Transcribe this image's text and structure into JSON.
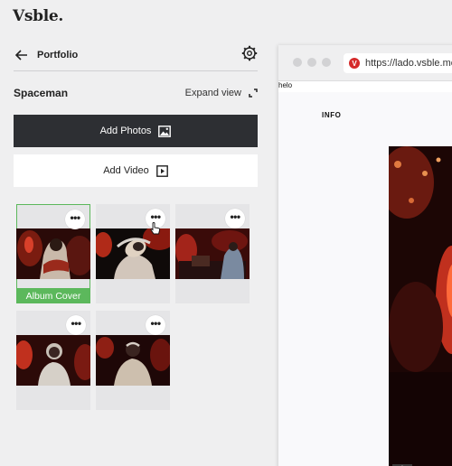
{
  "brand": {
    "logo_text": "Vsble."
  },
  "nav": {
    "title": "Portfolio",
    "back_icon": "arrow-left-icon",
    "settings_icon": "gear-icon"
  },
  "album": {
    "title": "Spaceman",
    "expand_label": "Expand view",
    "expand_icon": "expand-icon"
  },
  "actions": {
    "add_photos_label": "Add Photos",
    "add_photos_icon": "image-icon",
    "add_video_label": "Add Video",
    "add_video_icon": "play-box-icon"
  },
  "photos": [
    {
      "more_label": "•••",
      "badge": "Album Cover",
      "selected": true
    },
    {
      "more_label": "•••"
    },
    {
      "more_label": "•••"
    },
    {
      "more_label": "•••"
    },
    {
      "more_label": "•••"
    }
  ],
  "preview": {
    "url": "https://lado.vsble.me",
    "tooltip": "helo",
    "menu_info": "INFO",
    "favicon_letter": "V",
    "plus_label": "+"
  },
  "colors": {
    "accent_green": "#5cb85c",
    "dark_button": "#2d2f33",
    "favicon_red": "#d52b2b",
    "background": "#efeff0"
  }
}
